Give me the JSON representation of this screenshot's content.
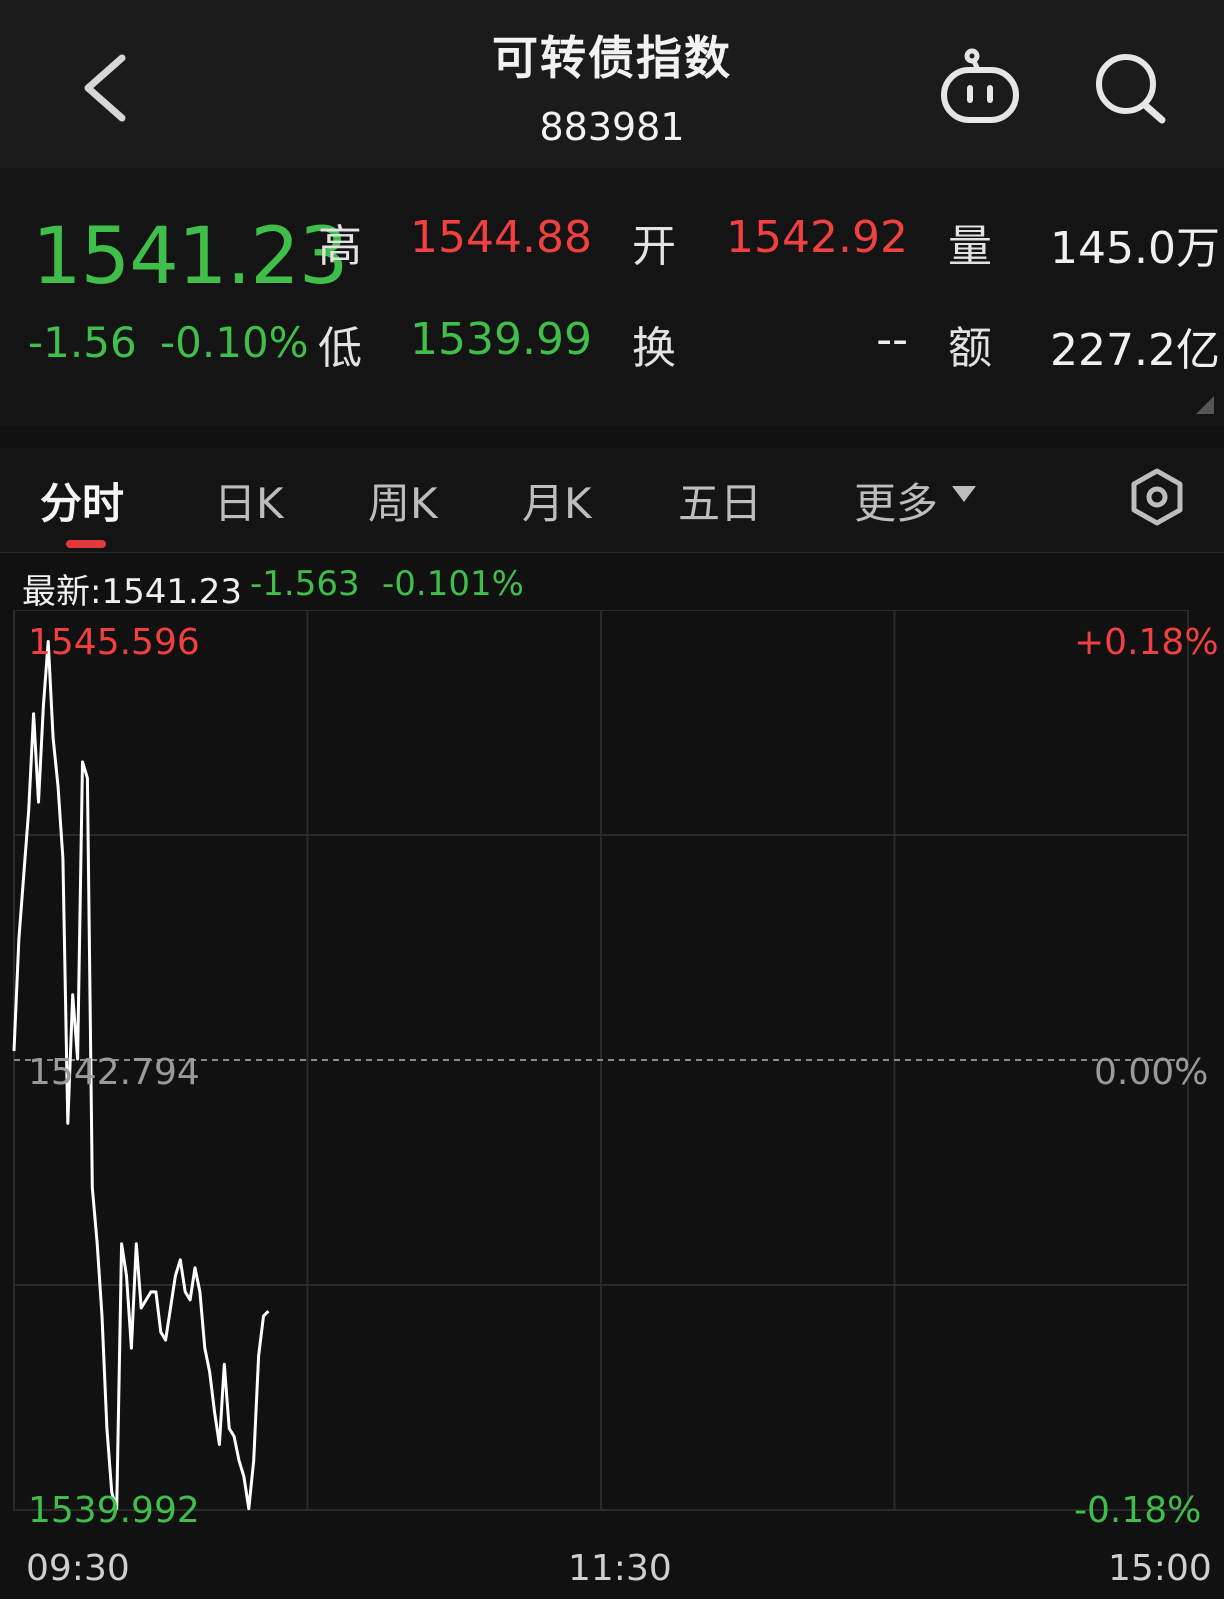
{
  "header": {
    "title": "可转债指数",
    "code": "883981",
    "back_icon": "chevron-left-icon",
    "robot_icon": "robot-icon",
    "search_icon": "search-icon"
  },
  "quote": {
    "price": "1541.23",
    "change": "-1.56",
    "change_pct": "-0.10%",
    "high_label": "高",
    "high": "1544.88",
    "low_label": "低",
    "low": "1539.99",
    "open_label": "开",
    "open": "1542.92",
    "turnover_label": "换",
    "turnover": "--",
    "volume_label": "量",
    "volume": "145.0万",
    "amount_label": "额",
    "amount": "227.2亿"
  },
  "tabs": [
    {
      "label": "分时",
      "active": true
    },
    {
      "label": "日K",
      "active": false
    },
    {
      "label": "周K",
      "active": false
    },
    {
      "label": "月K",
      "active": false
    },
    {
      "label": "五日",
      "active": false
    },
    {
      "label": "更多",
      "active": false
    }
  ],
  "latest_bar": {
    "latest_label": "最新:1541.23",
    "change": "-1.563",
    "change_pct": "-0.101%"
  },
  "colors": {
    "up": "#f04040",
    "down": "#3fbf4a",
    "line": "#ffffff",
    "grid": "#2a2a2a"
  },
  "chart_data": {
    "type": "line",
    "x_ticks": [
      "09:30",
      "11:30",
      "15:00"
    ],
    "y_max": "1545.596",
    "y_mid": "1542.794",
    "y_min": "1539.992",
    "pct_max": "+0.18%",
    "pct_mid": "0.00%",
    "pct_min": "-0.18%",
    "ylim": [
      1539.992,
      1545.596
    ],
    "reference": 1542.794,
    "total_minutes": 240,
    "x": [
      0,
      1,
      2,
      3,
      4,
      5,
      6,
      7,
      8,
      9,
      10,
      11,
      12,
      13,
      14,
      15,
      16,
      17,
      18,
      19,
      20,
      21,
      22,
      23,
      24,
      25,
      26,
      27,
      28,
      29,
      30,
      31,
      32,
      33,
      34,
      35,
      36,
      37,
      38,
      39,
      40,
      41,
      42,
      43,
      44,
      45,
      46,
      47,
      48,
      49,
      50,
      51,
      52
    ],
    "values": [
      1542.85,
      1543.55,
      1543.95,
      1544.35,
      1544.95,
      1544.4,
      1545.0,
      1545.4,
      1544.8,
      1544.5,
      1544.05,
      1542.4,
      1543.2,
      1542.8,
      1544.65,
      1544.55,
      1542.0,
      1541.65,
      1541.2,
      1540.5,
      1540.1,
      1540.0,
      1541.65,
      1541.45,
      1541.0,
      1541.65,
      1541.25,
      1541.3,
      1541.35,
      1541.35,
      1541.1,
      1541.05,
      1541.25,
      1541.45,
      1541.55,
      1541.35,
      1541.3,
      1541.5,
      1541.35,
      1541.0,
      1540.85,
      1540.6,
      1540.4,
      1540.9,
      1540.5,
      1540.45,
      1540.3,
      1540.2,
      1540.0,
      1540.3,
      1540.95,
      1541.2,
      1541.23
    ]
  }
}
